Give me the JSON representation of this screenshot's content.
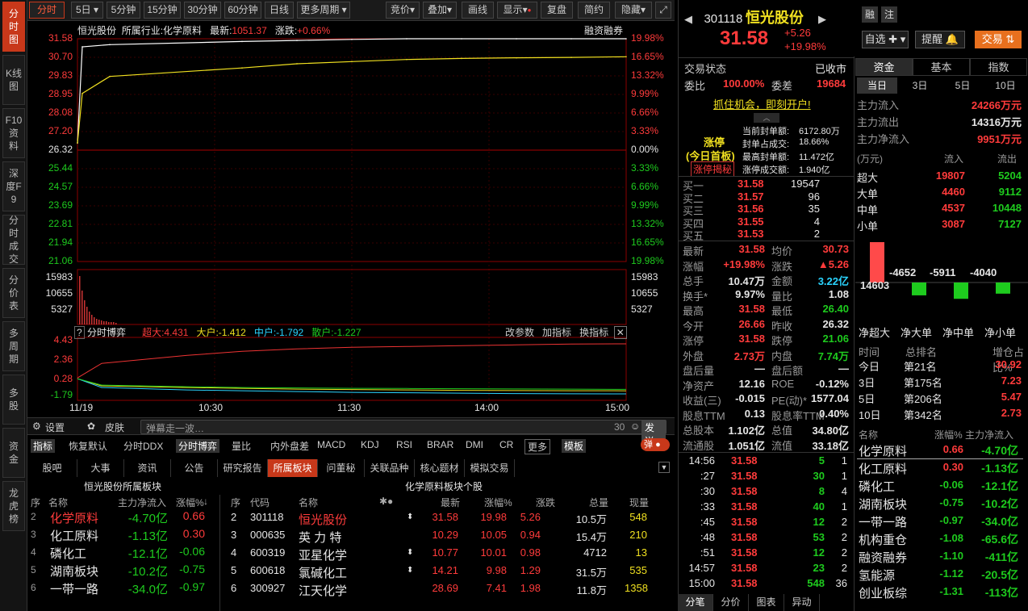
{
  "left_tabs": [
    "分时图",
    "K线图",
    "F10资料",
    "深度F9",
    "分时成交",
    "分价表",
    "多周期",
    "多股",
    "资金",
    "龙虎榜"
  ],
  "toolbar": {
    "items": [
      "分时",
      "5日",
      "5分钟",
      "15分钟",
      "30分钟",
      "60分钟",
      "日线",
      "更多周期"
    ],
    "right": [
      "竞价",
      "叠加",
      "画线",
      "显示",
      "复盘",
      "简约",
      "隐藏"
    ]
  },
  "chart": {
    "title": "恒光股份",
    "industry_label": "所属行业:",
    "industry": "化学原料",
    "latest_label": "最新:",
    "latest": "1051.37",
    "change_label": "涨跌:",
    "change": "+0.66%",
    "rz_label": "融资融券",
    "price_axis": [
      "31.58",
      "30.70",
      "29.83",
      "28.95",
      "28.08",
      "27.20",
      "26.32",
      "25.44",
      "24.57",
      "23.69",
      "22.81",
      "21.94",
      "21.06"
    ],
    "pct_axis": [
      "19.98%",
      "16.65%",
      "13.32%",
      "9.99%",
      "6.66%",
      "3.33%",
      "0.00%",
      "3.33%",
      "6.66%",
      "9.99%",
      "13.32%",
      "16.65%",
      "19.98%"
    ],
    "vol_axis": [
      "15983",
      "10655",
      "5327"
    ],
    "bottom_title": "分时博弈",
    "bottom_labels": [
      "超大:4.431",
      "大户:-1.412",
      "中户:-1.792",
      "散户:-1.227"
    ],
    "bottom_btns": [
      "改参数",
      "加指标",
      "换指标"
    ],
    "ind_axis": [
      "4.43",
      "2.36",
      "0.28",
      "-1.79"
    ],
    "time_axis": [
      "11/19",
      "10:30",
      "11:30",
      "14:00",
      "15:00"
    ]
  },
  "chart_data": {
    "type": "line",
    "x_range": [
      "09:30",
      "15:00"
    ],
    "price_ylim": [
      21.06,
      31.58
    ],
    "prev_close": 26.32,
    "series": [
      {
        "name": "price",
        "values": [
          26.66,
          31.2,
          31.3,
          31.45,
          31.5,
          31.55,
          31.58,
          31.58,
          31.58,
          31.58,
          31.58
        ]
      },
      {
        "name": "avg",
        "values": [
          26.66,
          29.0,
          29.8,
          30.2,
          30.4,
          30.5,
          30.6,
          30.65,
          30.68,
          30.7,
          30.73
        ]
      }
    ],
    "indicator": {
      "ylim": [
        -1.79,
        4.43
      ],
      "series": [
        {
          "name": "超大",
          "values": [
            0.2,
            2.0,
            3.0,
            3.5,
            3.8,
            4.0,
            4.1,
            4.2,
            4.3,
            4.4,
            4.43
          ]
        },
        {
          "name": "大户",
          "values": [
            0.1,
            -0.8,
            -1.0,
            -1.1,
            -1.2,
            -1.25,
            -1.3,
            -1.35,
            -1.38,
            -1.4,
            -1.41
          ]
        },
        {
          "name": "中户",
          "values": [
            0.1,
            -1.0,
            -1.3,
            -1.4,
            -1.5,
            -1.6,
            -1.65,
            -1.7,
            -1.75,
            -1.78,
            -1.79
          ]
        },
        {
          "name": "散户",
          "values": [
            0.1,
            -0.7,
            -0.9,
            -1.0,
            -1.05,
            -1.1,
            -1.12,
            -1.15,
            -1.18,
            -1.2,
            -1.23
          ]
        }
      ]
    }
  },
  "bar": {
    "settings": "设置",
    "skin": "皮肤",
    "danmu": "弹幕走一波…",
    "count": "30",
    "send": "发送"
  },
  "indtabs": [
    "指标",
    "恢复默认",
    "分时DDX",
    "分时博弈",
    "量比",
    "内外盘差",
    "MACD",
    "KDJ",
    "RSI",
    "BRAR",
    "DMI",
    "CR",
    "更多",
    "模板"
  ],
  "dan": "弹",
  "btabs": [
    "股吧",
    "大事",
    "资讯",
    "公告",
    "研究报告",
    "所属板块",
    "问董秘",
    "关联品种",
    "核心题材",
    "模拟交易"
  ],
  "blk": {
    "left_title": "恒光股份所属板块",
    "right_title": "化学原料板块个股",
    "lhead": [
      "序",
      "名称",
      "主力净流入",
      "涨幅%"
    ],
    "lrows": [
      [
        "2",
        "化学原料",
        "-4.70亿",
        "0.66"
      ],
      [
        "3",
        "化工原料",
        "-1.13亿",
        "0.30"
      ],
      [
        "4",
        "磷化工",
        "-12.1亿",
        "-0.06"
      ],
      [
        "5",
        "湖南板块",
        "-10.2亿",
        "-0.75"
      ],
      [
        "6",
        "一带一路",
        "-34.0亿",
        "-0.97"
      ]
    ],
    "rhead": [
      "序",
      "代码",
      "名称",
      "最新",
      "涨幅%",
      "涨跌",
      "总量",
      "现量"
    ],
    "rrows": [
      [
        "2",
        "301118",
        "恒光股份",
        "31.58",
        "19.98",
        "5.26",
        "10.5万",
        "548"
      ],
      [
        "3",
        "000635",
        "英 力 特",
        "10.29",
        "10.05",
        "0.94",
        "15.4万",
        "210"
      ],
      [
        "4",
        "600319",
        "亚星化学",
        "10.77",
        "10.01",
        "0.98",
        "4712",
        "13"
      ],
      [
        "5",
        "600618",
        "氯碱化工",
        "14.21",
        "9.98",
        "1.29",
        "31.5万",
        "535"
      ],
      [
        "6",
        "300927",
        "江天化学",
        "28.69",
        "7.41",
        "1.98",
        "11.8万",
        "1358"
      ]
    ]
  },
  "stock": {
    "code": "301118",
    "name": "恒光股份",
    "price": "31.58",
    "chg": "+5.26",
    "pct": "+19.98%",
    "rong": "融",
    "zhu": "注",
    "zixuan": "自选",
    "tixing": "提醒",
    "jiaoyi": "交易",
    "status_label": "交易状态",
    "status": "已收市",
    "wb_label": "委比",
    "wb": "100.00%",
    "wc_label": "委差",
    "wc": "19684",
    "open": "抓住机会，即刻开户!",
    "zt": "涨停",
    "zt2": "(今日首板)",
    "ztbtn": "涨停揭秘",
    "seal": [
      [
        "当前封单额:",
        "6172.80万"
      ],
      [
        "封单占成交:",
        "18.66%"
      ],
      [
        "最高封单额:",
        "11.472亿"
      ],
      [
        "涨停成交额:",
        "1.940亿"
      ]
    ],
    "bids": [
      [
        "买一",
        "31.58",
        "19547"
      ],
      [
        "买二",
        "31.57",
        "96"
      ],
      [
        "买三",
        "31.56",
        "35"
      ],
      [
        "买四",
        "31.55",
        "4"
      ],
      [
        "买五",
        "31.53",
        "2"
      ]
    ],
    "stats": [
      [
        "最新",
        "31.58",
        "均价",
        "30.73"
      ],
      [
        "涨幅",
        "+19.98%",
        "涨跌",
        "▲5.26"
      ],
      [
        "总手",
        "10.47万",
        "金额",
        "3.22亿"
      ],
      [
        "换手*",
        "9.97%",
        "量比",
        "1.08"
      ],
      [
        "最高",
        "31.58",
        "最低",
        "26.40"
      ],
      [
        "今开",
        "26.66",
        "昨收",
        "26.32"
      ],
      [
        "涨停",
        "31.58",
        "跌停",
        "21.06"
      ],
      [
        "外盘",
        "2.73万",
        "内盘",
        "7.74万"
      ],
      [
        "盘后量",
        "—",
        "盘后额",
        "—"
      ],
      [
        "净资产",
        "12.16",
        "ROE",
        "-0.12%"
      ],
      [
        "收益(三)",
        "-0.015",
        "PE(动)*",
        "1577.04"
      ],
      [
        "股息TTM",
        "0.13",
        "股息率TTM",
        "0.40%"
      ],
      [
        "总股本",
        "1.102亿",
        "总值",
        "34.80亿"
      ],
      [
        "流通股",
        "1.051亿",
        "流值",
        "33.18亿"
      ]
    ],
    "ticks": [
      [
        "14:56",
        "31.58",
        "5",
        "1"
      ],
      [
        ":27",
        "31.58",
        "30",
        "1"
      ],
      [
        ":30",
        "31.58",
        "8",
        "4"
      ],
      [
        ":33",
        "31.58",
        "40",
        "1"
      ],
      [
        ":45",
        "31.58",
        "12",
        "2"
      ],
      [
        ":48",
        "31.58",
        "53",
        "2"
      ],
      [
        ":51",
        "31.58",
        "12",
        "2"
      ],
      [
        "14:57",
        "31.58",
        "23",
        "2"
      ],
      [
        "15:00",
        "31.58",
        "548",
        "36"
      ]
    ],
    "ttabs": [
      "分笔",
      "分价",
      "图表",
      "异动"
    ]
  },
  "fund": {
    "tabs": [
      "资金",
      "基本",
      "指数"
    ],
    "periods": [
      "当日",
      "3日",
      "5日",
      "10日"
    ],
    "flows": [
      [
        "主力流入",
        "24266万元"
      ],
      [
        "主力流出",
        "14316万元"
      ],
      [
        "主力净流入",
        "9951万元"
      ]
    ],
    "head": [
      "(万元)",
      "流入",
      "流出"
    ],
    "rows": [
      [
        "超大",
        "19807",
        "5204"
      ],
      [
        "大单",
        "4460",
        "9112"
      ],
      [
        "中单",
        "4537",
        "10448"
      ],
      [
        "小单",
        "3087",
        "7127"
      ]
    ],
    "net": {
      "values": [
        14603,
        -4652,
        -5911,
        -4040
      ],
      "labels": [
        "14603",
        "-4652",
        "-5911",
        "-4040"
      ],
      "names": [
        "净超大",
        "净大单",
        "净中单",
        "净小单"
      ]
    },
    "rank_head": [
      "时间",
      "总排名",
      "增仓占比%"
    ],
    "ranks": [
      [
        "今日",
        "第21名",
        "30.92"
      ],
      [
        "3日",
        "第175名",
        "7.23"
      ],
      [
        "5日",
        "第206名",
        "5.47"
      ],
      [
        "10日",
        "第342名",
        "2.73"
      ]
    ],
    "sector_head": [
      "名称",
      "涨幅%",
      "主力净流入"
    ],
    "sectors": [
      [
        "化学原料",
        "0.66",
        "-4.70亿"
      ],
      [
        "化工原料",
        "0.30",
        "-1.13亿"
      ],
      [
        "磷化工",
        "-0.06",
        "-12.1亿"
      ],
      [
        "湖南板块",
        "-0.75",
        "-10.2亿"
      ],
      [
        "一带一路",
        "-0.97",
        "-34.0亿"
      ],
      [
        "机构重仓",
        "-1.08",
        "-65.6亿"
      ],
      [
        "融资融券",
        "-1.10",
        "-411亿"
      ],
      [
        "氢能源",
        "-1.12",
        "-20.5亿"
      ],
      [
        "创业板综",
        "-1.31",
        "-113亿"
      ]
    ]
  }
}
